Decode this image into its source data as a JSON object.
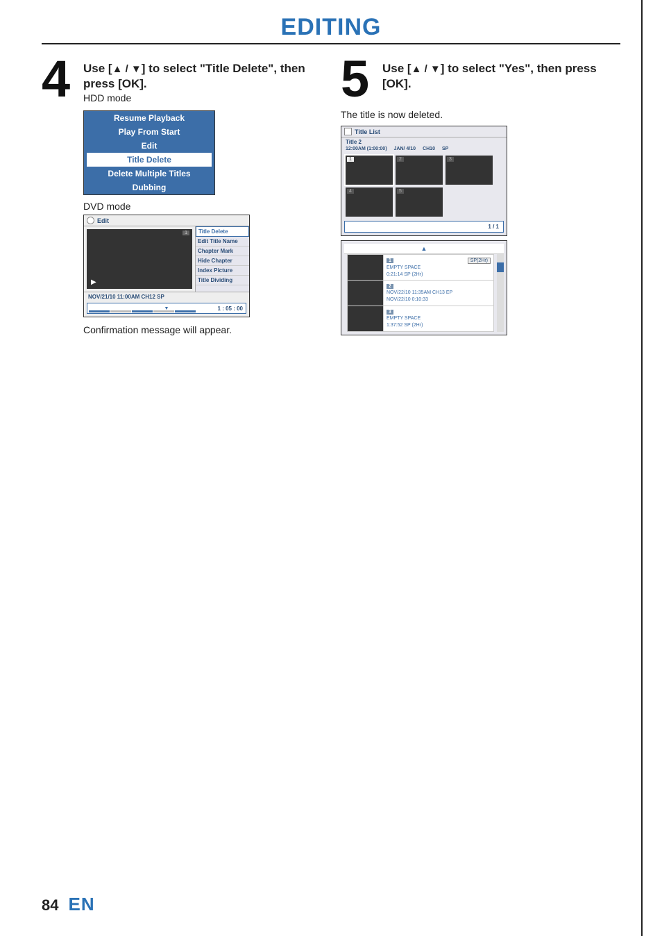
{
  "header": {
    "title": "EDITING"
  },
  "step4": {
    "number": "4",
    "lead_prefix": "Use [",
    "lead_arrows": "▲ / ▼",
    "lead_suffix": "] to select \"Title Delete\", then press [OK].",
    "mode_hdd": "HDD mode",
    "hdd_menu": {
      "items": [
        "Resume Playback",
        "Play From Start",
        "Edit",
        "Title Delete",
        "Delete Multiple Titles",
        "Dubbing"
      ],
      "selected_index": 3
    },
    "mode_dvd": "DVD mode",
    "dvd_panel": {
      "title": "Edit",
      "preview_tag": "1",
      "menu_items": [
        "Title Delete",
        "Edit Title Name",
        "Chapter Mark",
        "Hide Chapter",
        "Index Picture",
        "Title Dividing"
      ],
      "menu_selected_index": 0,
      "info_row": "NOV/21/10 11:00AM CH12 SP",
      "time": "1 : 05 : 00"
    },
    "confirm": "Confirmation message will appear."
  },
  "step5": {
    "number": "5",
    "lead_prefix": "Use [",
    "lead_arrows": "▲ / ▼",
    "lead_suffix": "] to select \"Yes\", then press [OK].",
    "deleted": "The title is now deleted.",
    "title_list": {
      "header": "Title List",
      "sub1": "Title 2",
      "sub2_time": "12:00AM (1:00:00)",
      "sub2_date": "JAN/  4/10",
      "sub2_ch": "CH10",
      "sub2_mode": "SP",
      "thumbs": [
        {
          "n": "1",
          "active": true
        },
        {
          "n": "2",
          "dim": true
        },
        {
          "n": "3",
          "dim": true
        },
        {
          "n": "4",
          "dim": true
        },
        {
          "n": "5",
          "dim": true
        }
      ],
      "page": "1 / 1"
    },
    "list_panel": {
      "rows": [
        {
          "idx": "1",
          "badge": "SP(2Hr)",
          "lines": [
            "EMPTY SPACE",
            "0:21:14  SP (2Hr)"
          ]
        },
        {
          "idx": "2",
          "badge": "",
          "lines": [
            "NOV/22/10  11:35AM CH13  EP",
            "NOV/22/10    0:10:33"
          ]
        },
        {
          "idx": "3",
          "badge": "",
          "lines": [
            "EMPTY SPACE",
            "1:37:52  SP (2Hr)"
          ]
        }
      ]
    }
  },
  "footer": {
    "page": "84",
    "lang": "EN"
  }
}
